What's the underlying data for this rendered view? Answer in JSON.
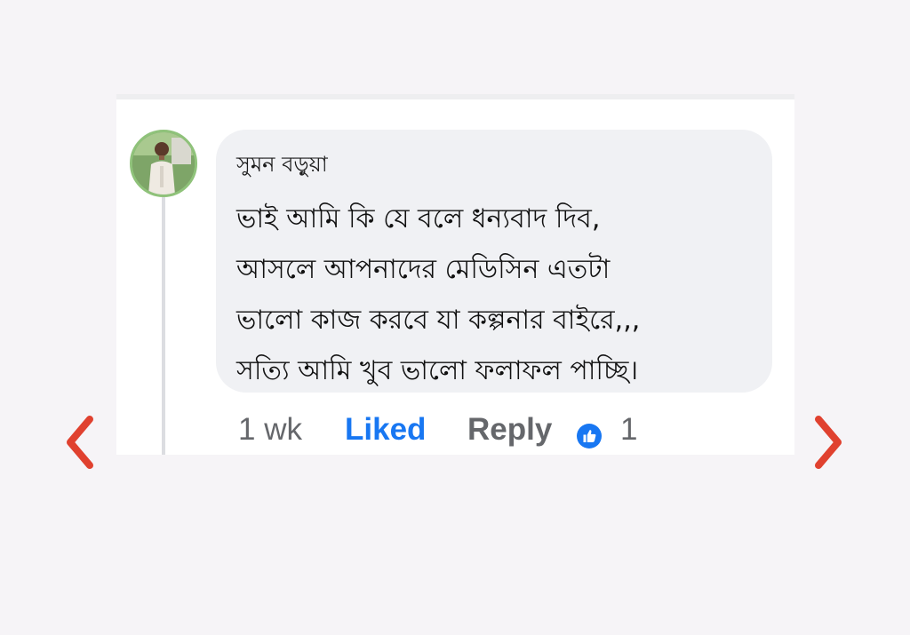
{
  "comment": {
    "author": "সুমন বড়ুয়া",
    "lines": [
      "ভাই আমি কি যে বলে ধন্যবাদ দিব,",
      "আসলে আপনাদের মেডিসিন এতটা",
      "ভালো কাজ করবে যা কল্পনার বাইরে,,,",
      "সত্যি আমি খুব ভালো ফলাফল পাচ্ছি।"
    ],
    "timestamp": "1 wk",
    "liked_label": "Liked",
    "reply_label": "Reply",
    "reaction_count": "1"
  },
  "icons": {
    "reaction": "thumbs-up-icon",
    "previous": "chevron-left-icon",
    "next": "chevron-right-icon"
  },
  "colors": {
    "accent": "#1877f2",
    "nav_arrow": "#e0412f",
    "top_border": "#c2188f",
    "bubble": "#f0f1f4",
    "muted_text": "#65676b"
  }
}
